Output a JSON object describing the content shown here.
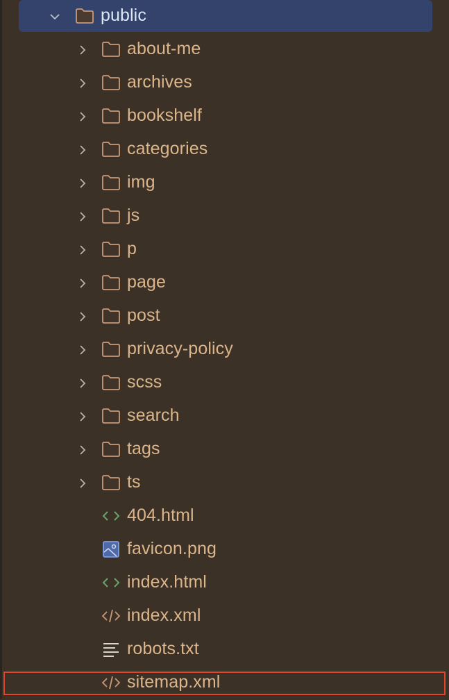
{
  "tree": {
    "root": {
      "name": "public",
      "expanded": true,
      "selected": true
    },
    "folders": [
      {
        "name": "about-me"
      },
      {
        "name": "archives"
      },
      {
        "name": "bookshelf"
      },
      {
        "name": "categories"
      },
      {
        "name": "img"
      },
      {
        "name": "js"
      },
      {
        "name": "p"
      },
      {
        "name": "page"
      },
      {
        "name": "post"
      },
      {
        "name": "privacy-policy"
      },
      {
        "name": "scss"
      },
      {
        "name": "search"
      },
      {
        "name": "tags"
      },
      {
        "name": "ts"
      }
    ],
    "files": [
      {
        "name": "404.html",
        "icon": "html-icon"
      },
      {
        "name": "favicon.png",
        "icon": "image-icon"
      },
      {
        "name": "index.html",
        "icon": "html-icon"
      },
      {
        "name": "index.xml",
        "icon": "xml-icon"
      },
      {
        "name": "robots.txt",
        "icon": "text-file-icon"
      },
      {
        "name": "sitemap.xml",
        "icon": "xml-icon",
        "highlighted": true
      }
    ]
  },
  "colors": {
    "selection": "#33436b",
    "highlight_border": "#e0452a",
    "folder_text": "#dcb58a"
  }
}
